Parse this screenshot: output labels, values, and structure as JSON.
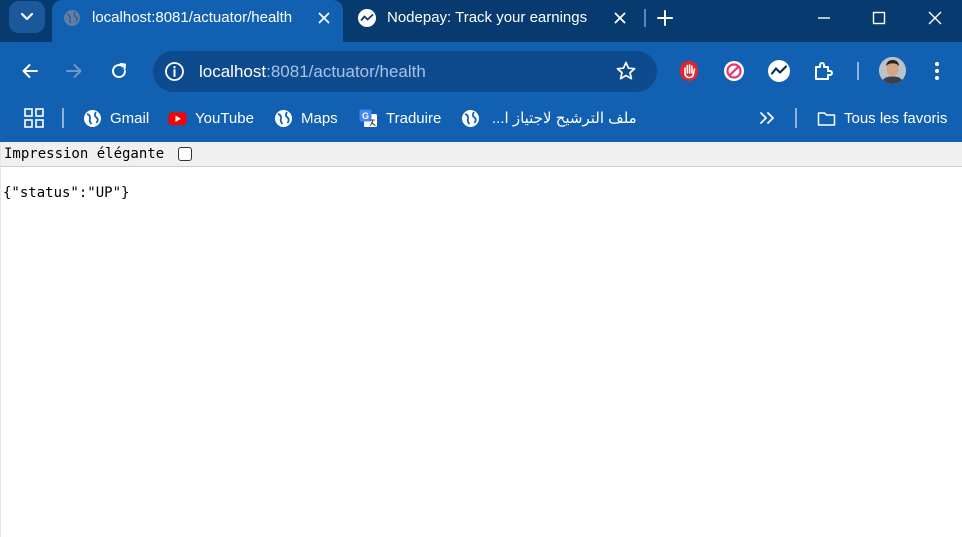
{
  "browser": {
    "tabs": [
      {
        "title": "localhost:8081/actuator/health",
        "favicon": "globe-icon",
        "active": true
      },
      {
        "title": "Nodepay: Track your earnings",
        "favicon": "nodepay-icon",
        "active": false
      }
    ],
    "toolbar": {
      "url_host": "localhost",
      "url_path": ":8081/actuator/health",
      "extensions": [
        "adblock-hand-icon",
        "blocker-icon",
        "nodepay-extension-icon",
        "puzzle-extensions-icon"
      ]
    },
    "bookmarks": [
      {
        "label": "Gmail",
        "icon": "globe-icon"
      },
      {
        "label": "YouTube",
        "icon": "youtube-icon"
      },
      {
        "label": "Maps",
        "icon": "globe-icon"
      },
      {
        "label": "Traduire",
        "icon": "translate-icon"
      },
      {
        "label": "ملف الترشيح لاجتياز ا...",
        "icon": "globe-icon"
      }
    ],
    "all_bookmarks_label": "Tous les favoris",
    "colors": {
      "frame": "#073a6e",
      "toolbar": "#1160b2",
      "omnibox": "#0d4a8e"
    }
  },
  "page": {
    "pretty_print_label": "Impression élégante",
    "pretty_print_checked": false,
    "json_body": "{\"status\":\"UP\"}"
  }
}
